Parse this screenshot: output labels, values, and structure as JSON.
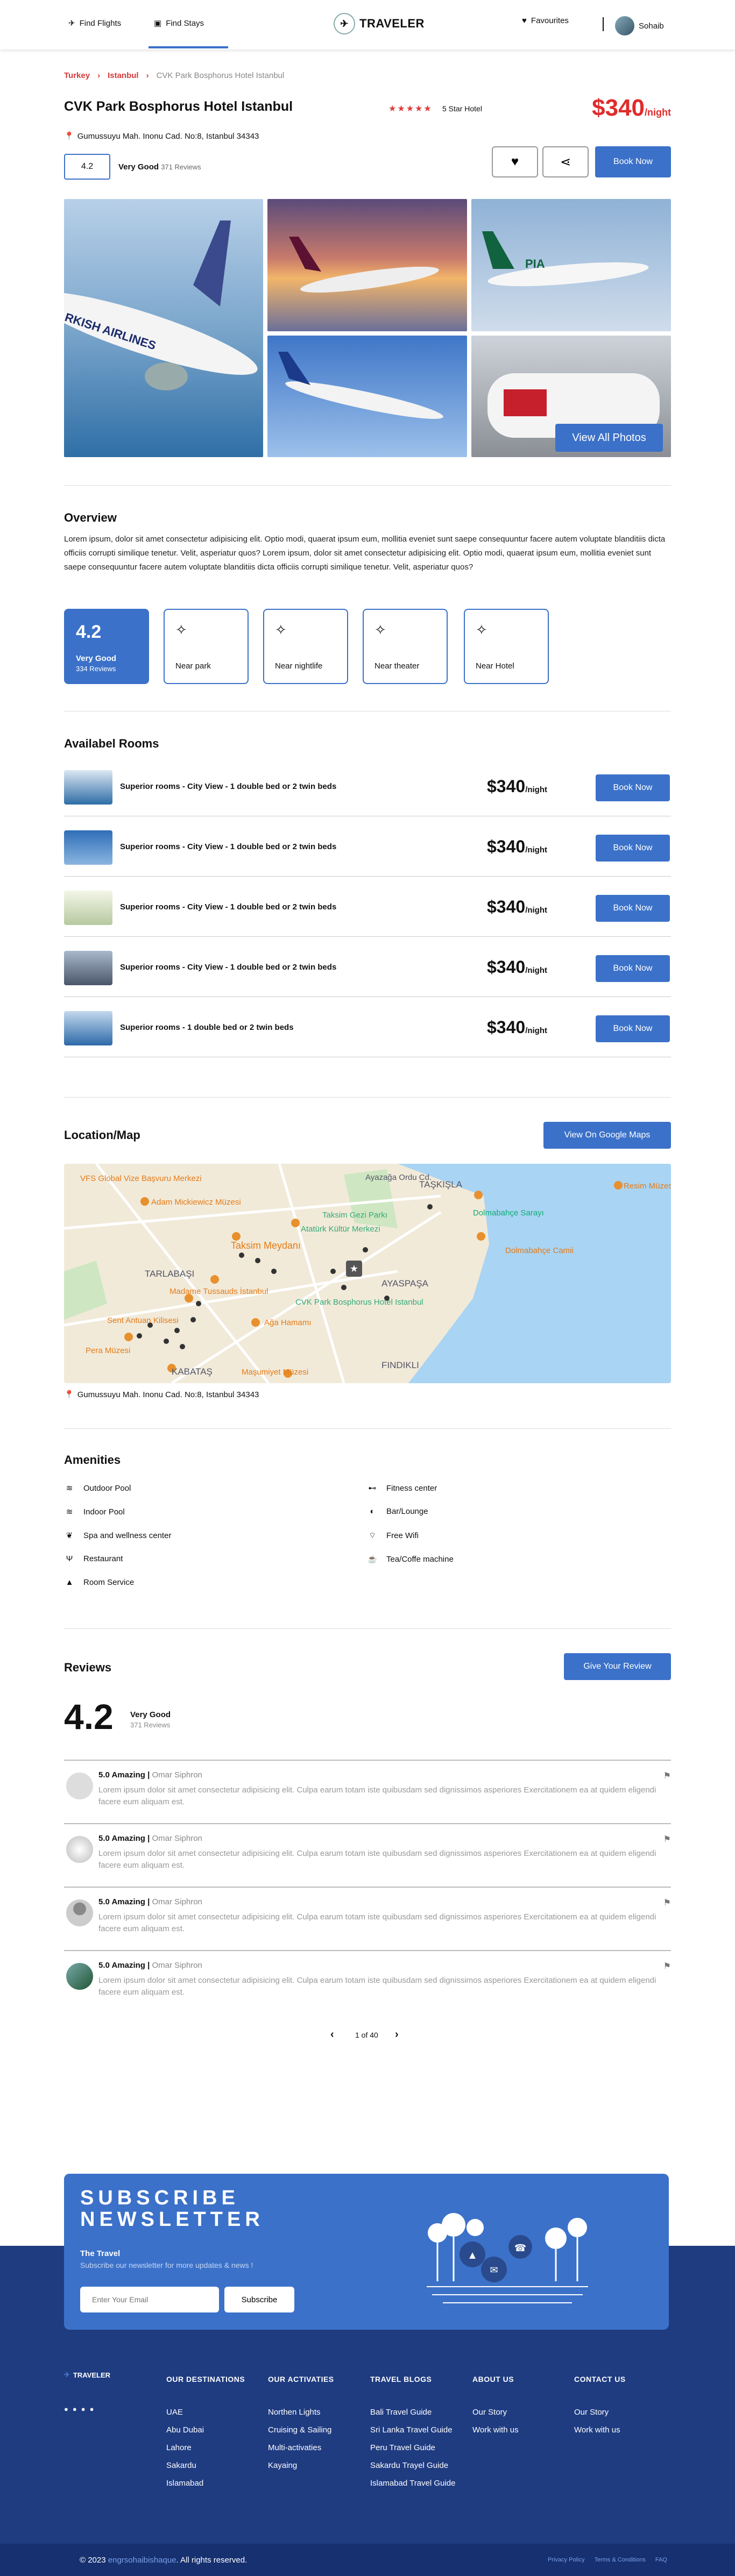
{
  "header": {
    "nav": [
      "Find Flights",
      "Find Stays"
    ],
    "logo": "TRAVELER",
    "favourites": "Favourites",
    "user": "Sohaib"
  },
  "breadcrumb": [
    "Turkey",
    "Istanbul",
    "CVK Park Bosphorus Hotel Istanbul"
  ],
  "hotel": {
    "name": "CVK Park Bosphorus Hotel Istanbul",
    "stars_label": "5 Star Hotel",
    "price": "$340",
    "price_unit": "/night",
    "address": "Gumussuyu Mah. Inonu Cad. No:8, Istanbul 34343",
    "rating": "4.2",
    "rating_word": "Very Good",
    "reviews_count": "371 Reviews",
    "book_label": "Book Now",
    "view_photos": "View All Photos"
  },
  "overview": {
    "heading": "Overview",
    "text": "Lorem ipsum, dolor sit amet consectetur adipisicing elit. Optio modi, quaerat ipsum eum, mollitia eveniet sunt saepe consequuntur facere autem voluptate blanditiis dicta officiis corrupti similique tenetur. Velit, asperiatur quos? Lorem ipsum, dolor sit amet consectetur adipisicing elit. Optio modi, quaerat ipsum eum, mollitia eveniet sunt saepe consequuntur facere autem voluptate blanditiis dicta officiis corrupti similique tenetur. Velit, asperiatur quos?",
    "score": "4.2",
    "score_word": "Very Good",
    "score_reviews": "334 Reviews",
    "features": [
      "Near park",
      "Near nightlife",
      "Near theater",
      "Near Hotel"
    ]
  },
  "rooms": {
    "heading": "Availabel Rooms",
    "items": [
      {
        "name": "Superior rooms - City View - 1 double bed or 2 twin beds",
        "price": "$340",
        "unit": "/night",
        "book": "Book Now"
      },
      {
        "name": "Superior rooms - City View - 1 double bed or 2 twin beds",
        "price": "$340",
        "unit": "/night",
        "book": "Book Now"
      },
      {
        "name": "Superior rooms - City View - 1 double bed or 2 twin beds",
        "price": "$340",
        "unit": "/night",
        "book": "Book Now"
      },
      {
        "name": "Superior rooms - City View - 1 double bed or 2 twin beds",
        "price": "$340",
        "unit": "/night",
        "book": "Book Now"
      },
      {
        "name": "Superior rooms - 1 double bed or 2 twin beds",
        "price": "$340",
        "unit": "/night",
        "book": "Book Now"
      }
    ]
  },
  "location": {
    "heading": "Location/Map",
    "button": "View On Google Maps",
    "address": "Gumussuyu Mah. Inonu Cad. No:8, Istanbul 34343",
    "map_labels": [
      "VFS Global Vize Başvuru Merkezi",
      "Adam Mickiewicz Müzesi",
      "Taksim Meydanı",
      "TARLABAŞI",
      "Madame Tussauds İstanbul",
      "Sent Antuan Kilisesi",
      "Pera Müzesi",
      "KABATAŞ",
      "Maşumiyet Müzesi",
      "Ağa Hamamı",
      "CVK Park Bosphorus Hotel Istanbul",
      "AYASPAŞA",
      "FINDIKLI",
      "Atatürk Kültür Merkezi",
      "TAŞKIŞLA",
      "Dolmabahçe Sarayı",
      "Dolmabahçe Camii",
      "Resim Müzesi",
      "Taksim Gezi Parkı",
      "Ayazağa Ordu Cd."
    ]
  },
  "amenities": {
    "heading": "Amenities",
    "left": [
      "Outdoor Pool",
      "Indoor Pool",
      "Spa and wellness center",
      "Restaurant",
      "Room Service"
    ],
    "right": [
      "Fitness center",
      "Bar/Lounge",
      "Free Wifi",
      "Tea/Coffe machine"
    ]
  },
  "reviews": {
    "heading": "Reviews",
    "button": "Give Your Review",
    "score": "4.2",
    "score_word": "Very Good",
    "score_reviews": "371 Reviews",
    "items": [
      {
        "title": "5.0 Amazing",
        "author": "Omar Siphron",
        "text": "Lorem ipsum dolor sit amet consectetur adipisicing elit. Culpa earum totam iste quibusdam sed dignissimos asperiores Exercitationem ea at quidem eligendi facere eum aliquam est."
      },
      {
        "title": "5.0 Amazing",
        "author": "Omar Siphron",
        "text": "Lorem ipsum dolor sit amet consectetur adipisicing elit. Culpa earum totam iste quibusdam sed dignissimos asperiores Exercitationem ea at quidem eligendi facere eum aliquam est."
      },
      {
        "title": "5.0 Amazing",
        "author": "Omar Siphron",
        "text": "Lorem ipsum dolor sit amet consectetur adipisicing elit. Culpa earum totam iste quibusdam sed dignissimos asperiores Exercitationem ea at quidem eligendi facere eum aliquam est."
      },
      {
        "title": "5.0 Amazing",
        "author": "Omar Siphron",
        "text": "Lorem ipsum dolor sit amet consectetur adipisicing elit. Culpa earum totam iste quibusdam sed dignissimos asperiores Exercitationem ea at quidem eligendi facere eum aliquam est."
      }
    ],
    "pagination": "1 of 40"
  },
  "newsletter": {
    "title1": "SUBSCRIBE",
    "title2": "NEWSLETTER",
    "brand": "The Travel",
    "sub": "Subscribe our newsletter for more updates & news !",
    "placeholder": "Enter Your Email",
    "button": "Subscribe"
  },
  "footer": {
    "logo": "TRAVELER",
    "cols": [
      {
        "title": "OUR DESTINATIONS",
        "items": [
          "UAE",
          "Abu Dubai",
          "Lahore",
          "Sakardu",
          "Islamabad"
        ]
      },
      {
        "title": "OUR ACTIVATIES",
        "items": [
          "Northen Lights",
          "Cruising & Sailing",
          "Multi-activaties",
          "Kayaing"
        ]
      },
      {
        "title": "TRAVEL BLOGS",
        "items": [
          "Bali Travel Guide",
          "Sri Lanka Travel Guide",
          "Peru Travel Guide",
          "Sakardu Trayel Guide",
          "Islamabad Travel Guide"
        ]
      },
      {
        "title": "ABOUT US",
        "items": [
          "Our Story",
          "Work with us"
        ]
      },
      {
        "title": "CONTACT US",
        "items": [
          "Our Story",
          "Work with us"
        ]
      }
    ],
    "copyright_year": "© 2023",
    "copyright_link": "engrsohaibishaque",
    "copyright_rest": ". All rights reserved.",
    "links": [
      "Privacy Policy",
      "Terms & Conditions",
      "FAQ"
    ]
  },
  "colors": {
    "accent": "#3b71c9",
    "price": "#e02b2b",
    "footer": "#1f3c81"
  }
}
